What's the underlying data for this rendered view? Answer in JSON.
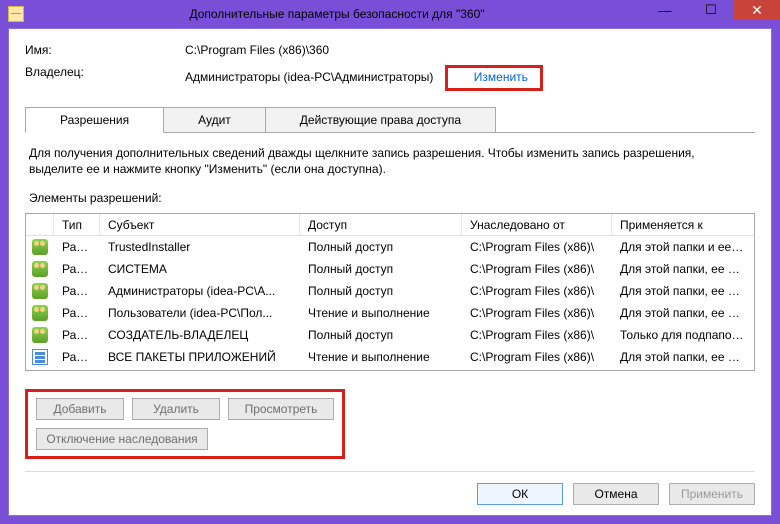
{
  "titlebar": {
    "title": "Дополнительные параметры безопасности  для \"360\""
  },
  "info": {
    "name_label": "Имя:",
    "name_value": "C:\\Program Files (x86)\\360",
    "owner_label": "Владелец:",
    "owner_value": "Администраторы (idea-PC\\Администраторы)",
    "change_link": "Изменить"
  },
  "tabs": {
    "permissions": "Разрешения",
    "audit": "Аудит",
    "effective": "Действующие права доступа"
  },
  "description": "Для получения дополнительных сведений дважды щелкните запись разрешения. Чтобы изменить запись разрешения, выделите ее и нажмите кнопку \"Изменить\" (если она доступна).",
  "list_label": "Элементы разрешений:",
  "columns": {
    "type": "Тип",
    "subject": "Субъект",
    "access": "Доступ",
    "inherited": "Унаследовано от",
    "applies": "Применяется к"
  },
  "rows": [
    {
      "icon": "users",
      "type": "Разр...",
      "subject": "TrustedInstaller",
      "access": "Полный доступ",
      "inherited": "C:\\Program Files (x86)\\",
      "applies": "Для этой папки и ее подпапок"
    },
    {
      "icon": "users",
      "type": "Разр...",
      "subject": "СИСТЕМА",
      "access": "Полный доступ",
      "inherited": "C:\\Program Files (x86)\\",
      "applies": "Для этой папки, ее подпапок ..."
    },
    {
      "icon": "users",
      "type": "Разр...",
      "subject": "Администраторы (idea-PC\\А...",
      "access": "Полный доступ",
      "inherited": "C:\\Program Files (x86)\\",
      "applies": "Для этой папки, ее подпапок ..."
    },
    {
      "icon": "users",
      "type": "Разр...",
      "subject": "Пользователи (idea-PC\\Пол...",
      "access": "Чтение и выполнение",
      "inherited": "C:\\Program Files (x86)\\",
      "applies": "Для этой папки, ее подпапок ..."
    },
    {
      "icon": "users",
      "type": "Разр...",
      "subject": "СОЗДАТЕЛЬ-ВЛАДЕЛЕЦ",
      "access": "Полный доступ",
      "inherited": "C:\\Program Files (x86)\\",
      "applies": "Только для подпапок и файл..."
    },
    {
      "icon": "pkg",
      "type": "Разр...",
      "subject": "ВСЕ ПАКЕТЫ ПРИЛОЖЕНИЙ",
      "access": "Чтение и выполнение",
      "inherited": "C:\\Program Files (x86)\\",
      "applies": "Для этой папки, ее подпапок ..."
    }
  ],
  "buttons": {
    "add": "Добавить",
    "remove": "Удалить",
    "view": "Просмотреть",
    "disable_inherit": "Отключение наследования"
  },
  "footer": {
    "ok": "ОК",
    "cancel": "Отмена",
    "apply": "Применить"
  }
}
